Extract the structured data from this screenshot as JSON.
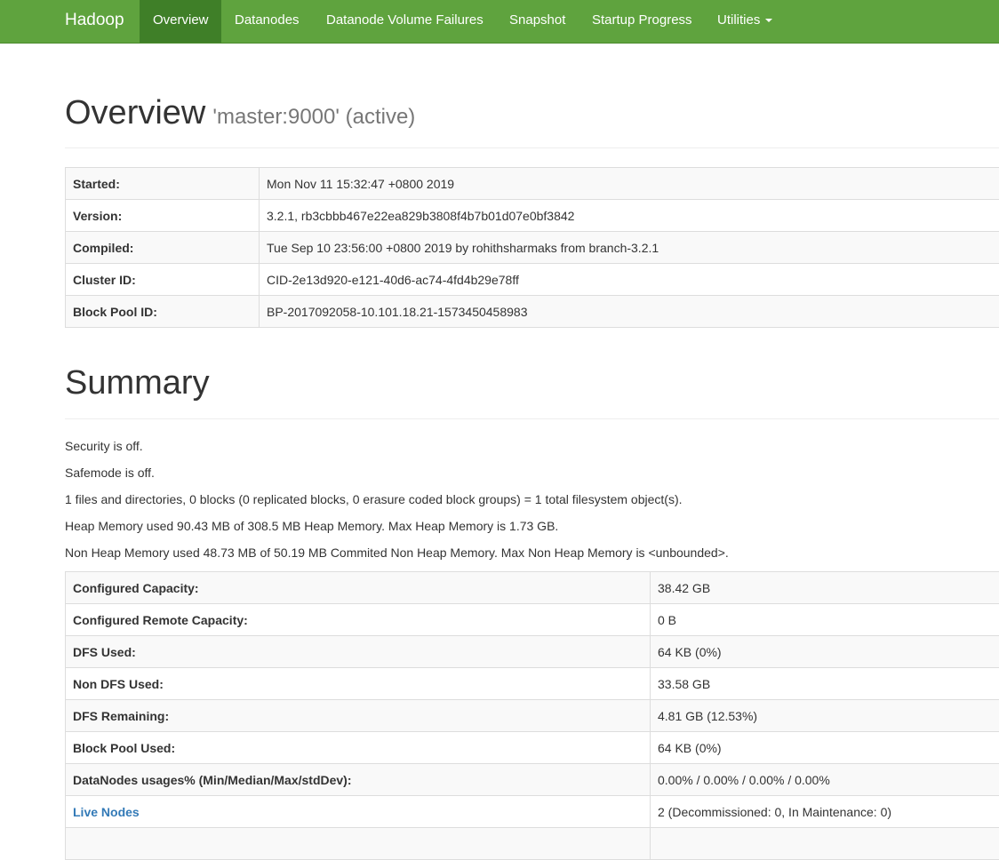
{
  "navbar": {
    "brand": "Hadoop",
    "items": [
      {
        "label": "Overview"
      },
      {
        "label": "Datanodes"
      },
      {
        "label": "Datanode Volume Failures"
      },
      {
        "label": "Snapshot"
      },
      {
        "label": "Startup Progress"
      },
      {
        "label": "Utilities"
      }
    ]
  },
  "overview": {
    "title": "Overview",
    "subtitle": "'master:9000' (active)",
    "rows": [
      {
        "label": "Started:",
        "value": "Mon Nov 11 15:32:47 +0800 2019"
      },
      {
        "label": "Version:",
        "value": "3.2.1, rb3cbbb467e22ea829b3808f4b7b01d07e0bf3842"
      },
      {
        "label": "Compiled:",
        "value": "Tue Sep 10 23:56:00 +0800 2019 by rohithsharmaks from branch-3.2.1"
      },
      {
        "label": "Cluster ID:",
        "value": "CID-2e13d920-e121-40d6-ac74-4fd4b29e78ff"
      },
      {
        "label": "Block Pool ID:",
        "value": "BP-2017092058-10.101.18.21-1573450458983"
      }
    ]
  },
  "summary": {
    "title": "Summary",
    "lines": [
      "Security is off.",
      "Safemode is off.",
      "1 files and directories, 0 blocks (0 replicated blocks, 0 erasure coded block groups) = 1 total filesystem object(s).",
      "Heap Memory used 90.43 MB of 308.5 MB Heap Memory. Max Heap Memory is 1.73 GB.",
      "Non Heap Memory used 48.73 MB of 50.19 MB Commited Non Heap Memory. Max Non Heap Memory is <unbounded>."
    ],
    "rows": [
      {
        "label": "Configured Capacity:",
        "value": "38.42 GB"
      },
      {
        "label": "Configured Remote Capacity:",
        "value": "0 B"
      },
      {
        "label": "DFS Used:",
        "value": "64 KB (0%)"
      },
      {
        "label": "Non DFS Used:",
        "value": "33.58 GB"
      },
      {
        "label": "DFS Remaining:",
        "value": "4.81 GB (12.53%)"
      },
      {
        "label": "Block Pool Used:",
        "value": "64 KB (0%)"
      },
      {
        "label": "DataNodes usages% (Min/Median/Max/stdDev):",
        "value": "0.00% / 0.00% / 0.00% / 0.00%"
      },
      {
        "label": "Live Nodes",
        "value": "2 (Decommissioned: 0, In Maintenance: 0)"
      }
    ]
  }
}
